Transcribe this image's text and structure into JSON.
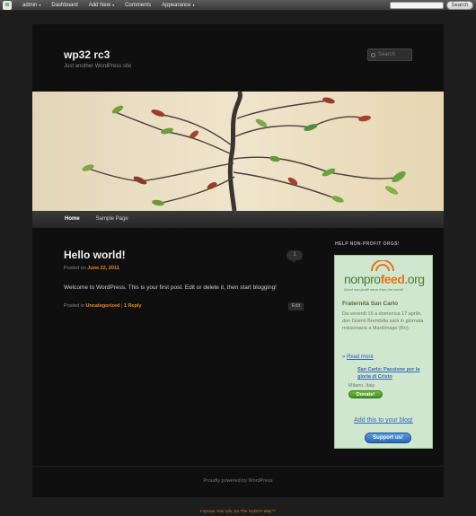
{
  "admin_bar": {
    "items": [
      {
        "label": "admin",
        "caret": "▾"
      },
      {
        "label": "Dashboard",
        "caret": ""
      },
      {
        "label": "Add New",
        "caret": "▾"
      },
      {
        "label": "Comments",
        "caret": ""
      },
      {
        "label": "Appearance",
        "caret": "▾"
      }
    ],
    "search_button": "Search"
  },
  "site": {
    "title": "wp32 rc3",
    "description": "Just another WordPress site",
    "search_placeholder": "Search"
  },
  "nav": {
    "items": [
      {
        "label": "Home"
      },
      {
        "label": "Sample Page"
      }
    ]
  },
  "post": {
    "title": "Hello world!",
    "comment_count": "1",
    "posted_prefix": "Posted on ",
    "date": "June 22, 2011",
    "content": "Welcome to WordPress. This is your first post. Edit or delete it, then start blogging!",
    "meta_prefix": "Posted in ",
    "category": "Uncategorized",
    "separator": " | ",
    "reply": "1 Reply",
    "edit": "Edit"
  },
  "sidebar": {
    "widget_title": "HELP NON-PROFIT ORGS!",
    "logo": {
      "part1": "nonpro",
      "part2": "feed",
      "part3": ".org"
    },
    "tagline": "Good non-profit news from the world!",
    "org_name": "Fraternità San Carlo",
    "description": "Da venerdì 15 a domenica 17 aprile, don Gianni Brembilla sarà in giornata missionaria a Mardimago (Ro).",
    "read_more": "Read more",
    "read_more_prefix": "» ",
    "event_title": "San Carlo: Passione per la gloria di Cristo",
    "event_place": "Milano, Italy",
    "donate": "Donate!",
    "add_to_blog": "Add this to your blog!",
    "support": "Support us!"
  },
  "footer": {
    "text": "Proudly powered by WordPress"
  },
  "bottom_credit": "Improve Your Life, Do The myDGY Way™"
}
